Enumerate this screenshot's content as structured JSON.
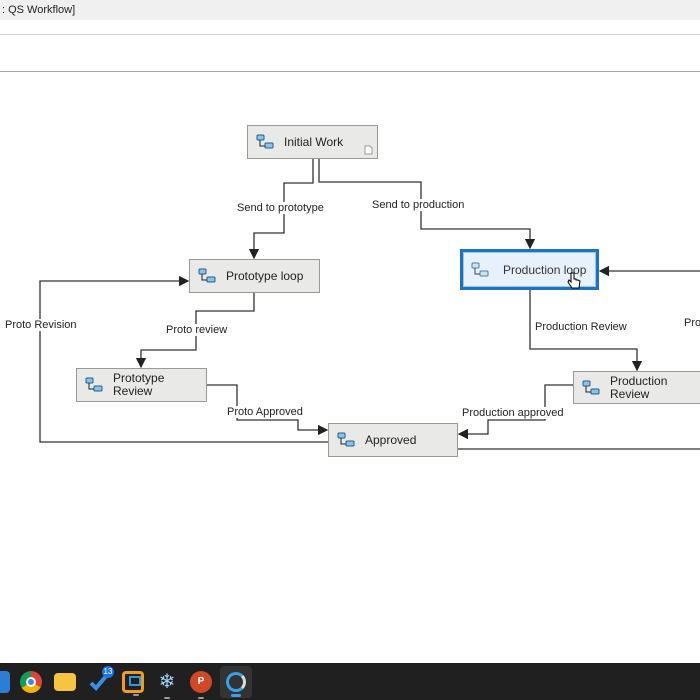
{
  "window": {
    "title": ": QS Workflow]"
  },
  "nodes": {
    "initial_work": "Initial Work",
    "prototype_loop": "Prototype loop",
    "production_loop": "Production loop",
    "prototype_review": "Prototype Review",
    "approved": "Approved",
    "production_review": "Production Review"
  },
  "edges": {
    "send_to_prototype": "Send to prototype",
    "send_to_production": "Send to production",
    "proto_review": "Proto review",
    "proto_approved": "Proto Approved",
    "proto_revision": "Proto Revision",
    "production_review": "Production Review",
    "production_approved": "Production approved",
    "offscreen": "Pro"
  },
  "taskbar": {
    "apps": [
      "windows-start",
      "chrome",
      "file-explorer",
      "vscode",
      "remote-desktop",
      "snowflake",
      "powerpoint",
      "workflow-app"
    ],
    "badge_count": "13",
    "active": "workflow-app"
  },
  "colors": {
    "selection": "#1f72c0",
    "node_bg": "#e9e9e7"
  }
}
